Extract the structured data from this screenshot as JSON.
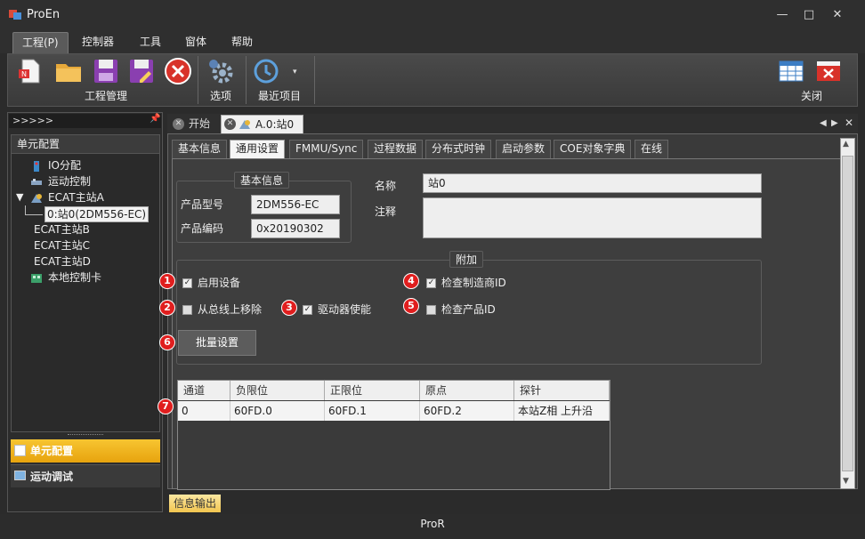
{
  "window": {
    "title": "ProEn"
  },
  "menu": {
    "items": [
      "工程(P)",
      "控制器",
      "工具",
      "窗体",
      "帮助"
    ]
  },
  "ribbon": {
    "groups": [
      {
        "label": "工程管理"
      },
      {
        "label": "选项"
      },
      {
        "label": "最近项目"
      },
      {
        "label": "关闭"
      }
    ]
  },
  "left": {
    "header": ">>>>>",
    "section_title": "单元配置",
    "tree": [
      {
        "label": "IO分配",
        "icon": "io-icon"
      },
      {
        "label": "运动控制",
        "icon": "motion-icon"
      },
      {
        "label": "ECAT主站A",
        "icon": "master-icon"
      },
      {
        "label": "0:站0(2DM556-EC)",
        "icon": "station-icon"
      },
      {
        "label": "ECAT主站B",
        "icon": ""
      },
      {
        "label": "ECAT主站C",
        "icon": ""
      },
      {
        "label": "ECAT主站D",
        "icon": ""
      },
      {
        "label": "本地控制卡",
        "icon": "card-icon"
      }
    ],
    "nav": {
      "unit_config": "单元配置",
      "motion_debug": "运动调试"
    }
  },
  "doc_tabs": {
    "start": "开始",
    "station": "A.0:站0"
  },
  "sub_tabs": [
    "基本信息",
    "通用设置",
    "FMMU/Sync",
    "过程数据",
    "分布式时钟",
    "启动参数",
    "COE对象字典",
    "在线"
  ],
  "basic_info": {
    "title": "基本信息",
    "product_model_label": "产品型号",
    "product_model": "2DM556-EC",
    "product_code_label": "产品编码",
    "product_code": "0x20190302",
    "name_label": "名称",
    "name_value": "站0",
    "note_label": "注释",
    "note_value": ""
  },
  "extra": {
    "title": "附加",
    "enable_device": {
      "label": "启用设备",
      "checked": true,
      "badge": "1"
    },
    "remove_from_bus": {
      "label": "从总线上移除",
      "checked": false,
      "badge": "2"
    },
    "drive_enable": {
      "label": "驱动器使能",
      "checked": true,
      "badge": "3"
    },
    "check_vendor": {
      "label": "检查制造商ID",
      "checked": true,
      "badge": "4"
    },
    "check_product": {
      "label": "检查产品ID",
      "checked": false,
      "badge": "5"
    },
    "batch_badge": "6",
    "batch_label": "批量设置"
  },
  "table": {
    "badge": "7",
    "headers": [
      "通道",
      "负限位",
      "正限位",
      "原点",
      "探针"
    ],
    "rows": [
      [
        "0",
        "60FD.0",
        "60FD.1",
        "60FD.2",
        "本站Z相 上升沿"
      ]
    ]
  },
  "output_tab": "信息输出",
  "status_text": "ProR"
}
